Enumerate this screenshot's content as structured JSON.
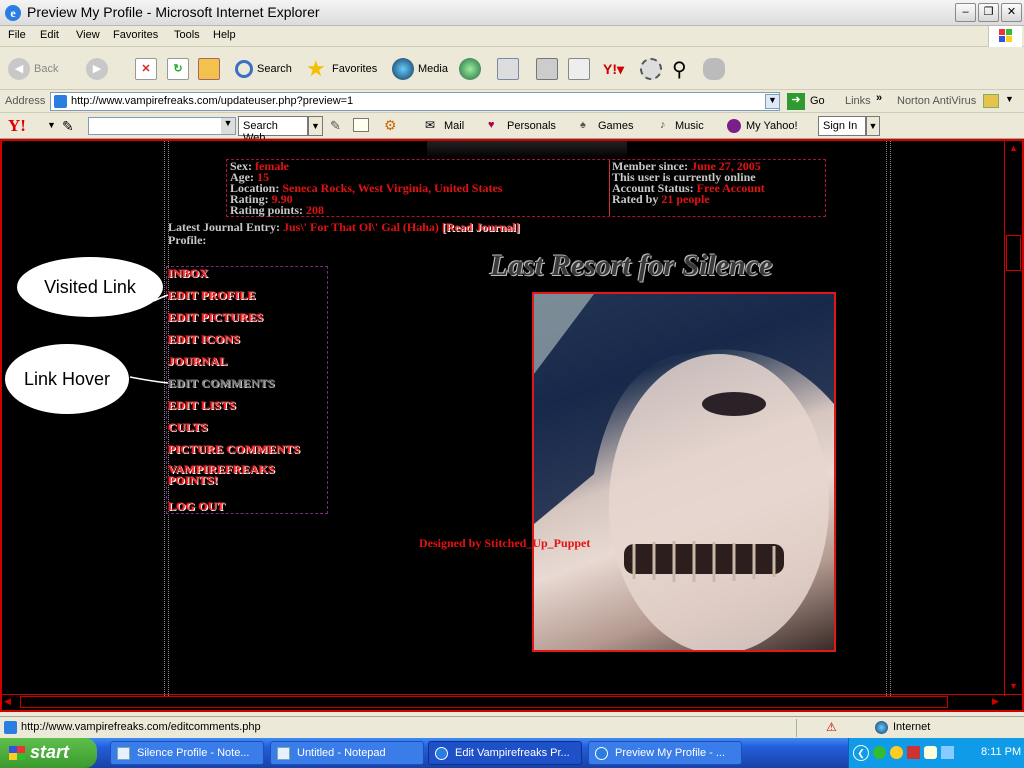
{
  "window": {
    "title": "Preview My Profile - Microsoft Internet Explorer"
  },
  "menu": [
    "File",
    "Edit",
    "View",
    "Favorites",
    "Tools",
    "Help"
  ],
  "toolbar": {
    "back": "Back",
    "search": "Search",
    "favorites": "Favorites",
    "media": "Media"
  },
  "address": {
    "label": "Address",
    "url": "http://www.vampirefreaks.com/updateuser.php?preview=1",
    "go": "Go",
    "links": "Links",
    "norton": "Norton AntiVirus"
  },
  "yahoo": {
    "search_web": "Search Web",
    "mail": "Mail",
    "personals": "Personals",
    "games": "Games",
    "music": "Music",
    "my_yahoo": "My Yahoo!",
    "sign_in": "Sign In"
  },
  "profile": {
    "sex_label": "Sex:",
    "sex": "female",
    "age_label": "Age:",
    "age": "15",
    "location_label": "Location:",
    "location": "Seneca Rocks, West Virginia, United States",
    "rating_label": "Rating:",
    "rating": "9.90",
    "points_label": "Rating points:",
    "points": "208",
    "member_label": "Member since:",
    "member": "June 27, 2005",
    "online": "This user is currently online",
    "account_label": "Account Status:",
    "account": "Free Account",
    "rated_label": "Rated by",
    "rated": "21 people",
    "journal_label": "Latest Journal Entry:",
    "journal": "Jus\\' For That Ol\\' Gal (Haha)",
    "read_journal": "[Read Journal]",
    "profile_label": "Profile:",
    "banner": "Last Resort for Silence",
    "designed_by": "Designed by Stitched_Up_Puppet"
  },
  "nav": [
    "INBOX",
    "EDIT PROFILE",
    "EDIT PICTURES",
    "EDIT ICONS",
    "JOURNAL",
    "EDIT COMMENTS",
    "EDIT LISTS",
    "CULTS",
    "PICTURE COMMENTS",
    "VAMPIREFREAKS POINTS!",
    "LOG OUT"
  ],
  "annotations": {
    "visited": "Visited Link",
    "hover": "Link Hover"
  },
  "status": {
    "url": "http://www.vampirefreaks.com/editcomments.php",
    "zone": "Internet"
  },
  "taskbar": {
    "start": "start",
    "tasks": [
      "Silence Profile - Note...",
      "Untitled - Notepad",
      "Edit Vampirefreaks Pr...",
      "Preview My Profile - ..."
    ],
    "clock": "8:11 PM"
  }
}
